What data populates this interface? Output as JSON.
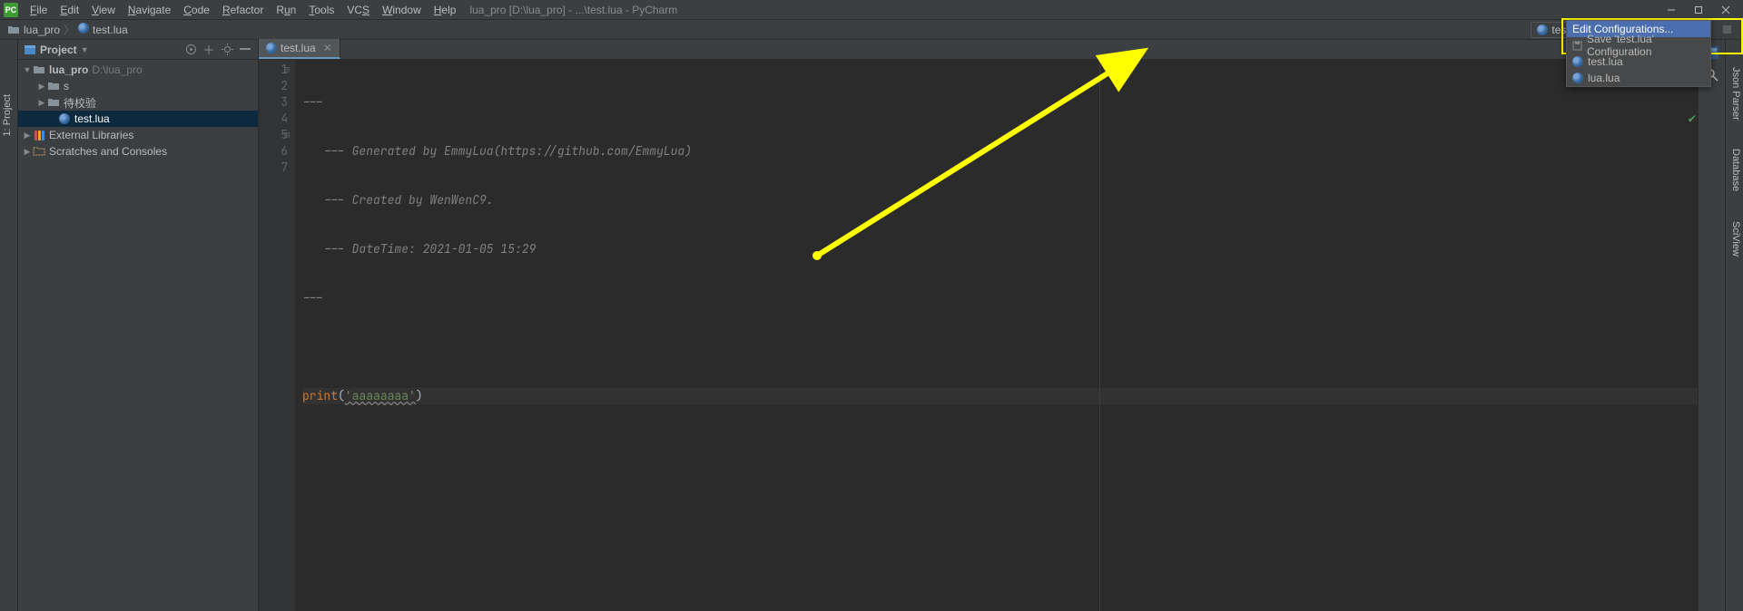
{
  "title": "lua_pro [D:\\lua_pro] - ...\\test.lua - PyCharm",
  "menus": [
    "File",
    "Edit",
    "View",
    "Navigate",
    "Code",
    "Refactor",
    "Run",
    "Tools",
    "VCS",
    "Window",
    "Help"
  ],
  "breadcrumb": {
    "project": "lua_pro",
    "file": "test.lua"
  },
  "run_config": {
    "selected": "test.lua"
  },
  "dropdown": {
    "edit": "Edit Configurations...",
    "save": "Save 'test.lua' Configuration",
    "items": [
      "test.lua",
      "lua.lua"
    ]
  },
  "project_panel": {
    "title": "Project",
    "tree": {
      "root": {
        "name": "lua_pro",
        "path": "D:\\lua_pro"
      },
      "children": [
        {
          "name": "s",
          "type": "folder"
        },
        {
          "name": "待校验",
          "type": "folder"
        },
        {
          "name": "test.lua",
          "type": "lua",
          "selected": true
        }
      ],
      "ext_lib": "External Libraries",
      "scratches": "Scratches and Consoles"
    }
  },
  "editor": {
    "tab": "test.lua",
    "lines": [
      {
        "n": 1,
        "text": "---"
      },
      {
        "n": 2,
        "text": "--- Generated by EmmyLua(https://github.com/EmmyLua)"
      },
      {
        "n": 3,
        "text": "--- Created by WenWenC9."
      },
      {
        "n": 4,
        "text": "--- DateTime: 2021-01-05 15:29"
      },
      {
        "n": 5,
        "text": "---"
      },
      {
        "n": 6,
        "text": ""
      },
      {
        "n": 7,
        "kw": "print",
        "str": "'aaaaaaaa'"
      }
    ]
  },
  "right_tools": {
    "json": "Json Parser",
    "db": "Database",
    "sci": "SciView"
  },
  "left_tool": "1: Project"
}
